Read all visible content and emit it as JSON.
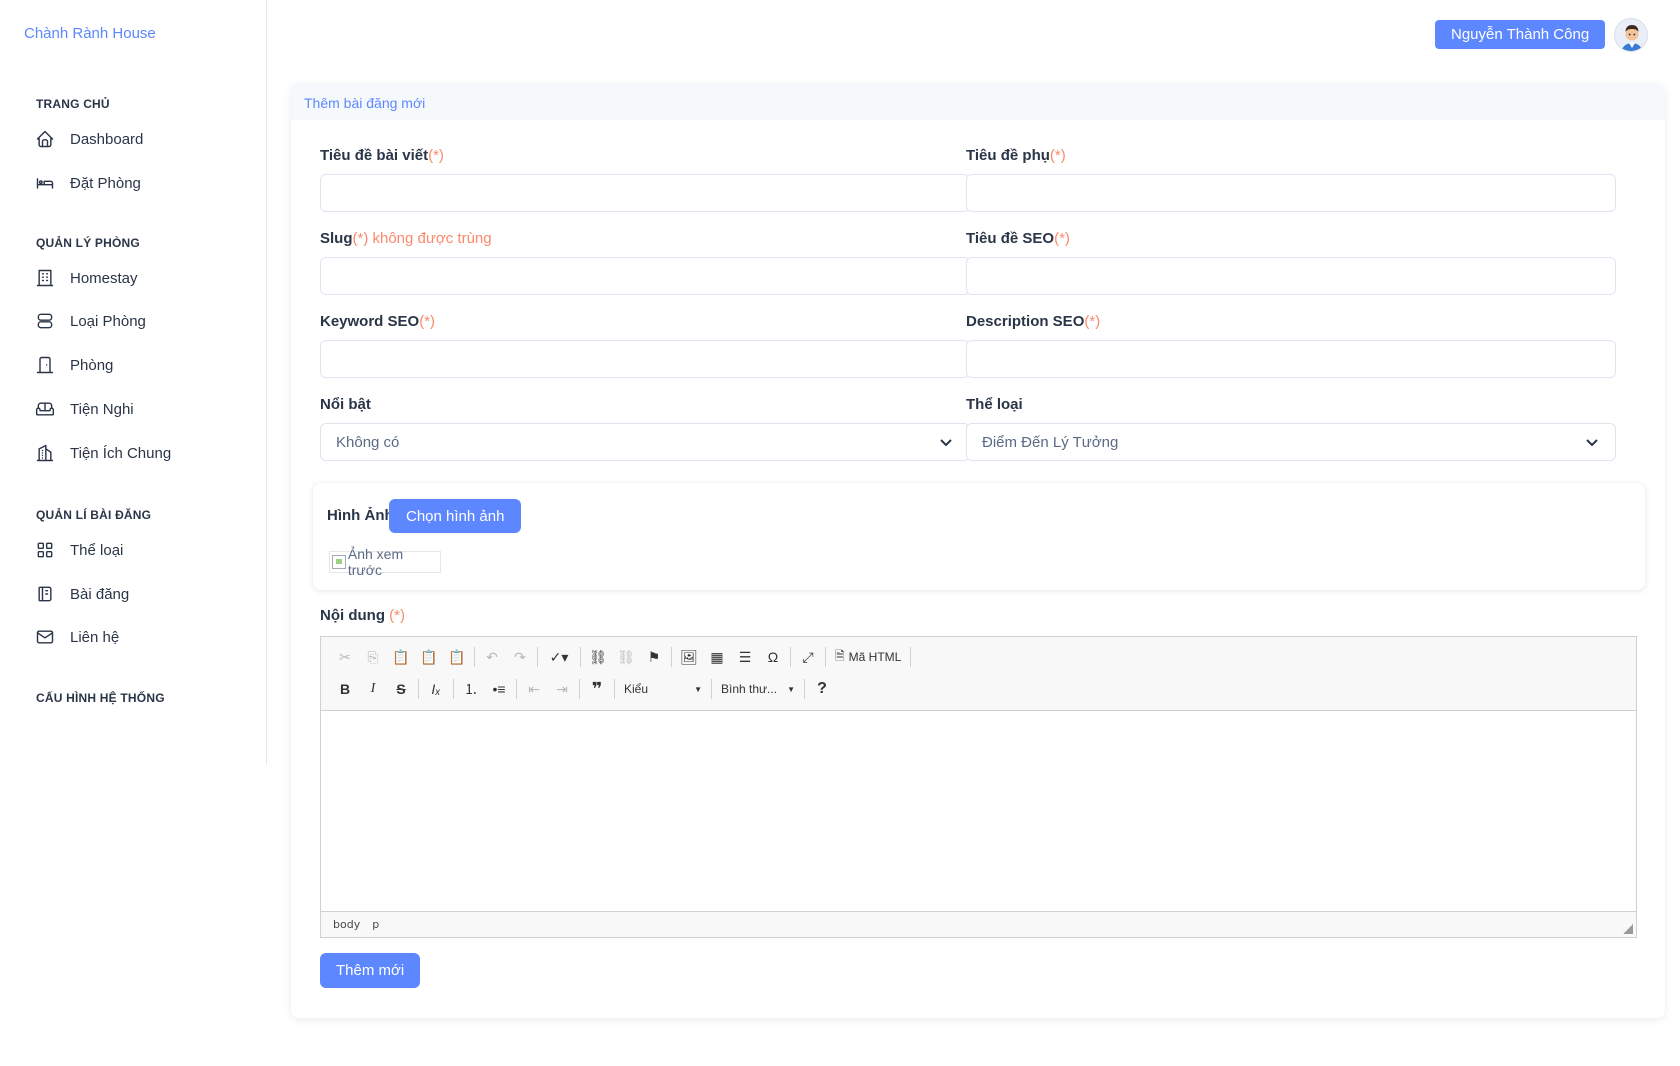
{
  "sidebar": {
    "brand": "Chành Rành House",
    "sections": [
      {
        "title": "TRANG CHỦ",
        "items": [
          {
            "label": "Dashboard",
            "icon": "home-icon"
          },
          {
            "label": "Đặt Phòng",
            "icon": "bed-icon"
          }
        ]
      },
      {
        "title": "QUẢN LÝ PHÒNG",
        "items": [
          {
            "label": "Homestay",
            "icon": "building-icon"
          },
          {
            "label": "Loại Phòng",
            "icon": "server-icon"
          },
          {
            "label": "Phòng",
            "icon": "door-icon"
          },
          {
            "label": "Tiện Nghi",
            "icon": "sofa-icon"
          },
          {
            "label": "Tiện Ích Chung",
            "icon": "buildings-icon"
          }
        ]
      },
      {
        "title": "QUẢN LÍ BÀI ĐĂNG",
        "items": [
          {
            "label": "Thể loại",
            "icon": "category-icon"
          },
          {
            "label": "Bài đăng",
            "icon": "notebook-icon"
          },
          {
            "label": "Liên hệ",
            "icon": "mail-icon"
          }
        ]
      },
      {
        "title": "CẤU HÌNH HỆ THỐNG",
        "items": []
      }
    ]
  },
  "header": {
    "user_name": "Nguyễn Thành Công",
    "avatar_icon": "user-avatar"
  },
  "card": {
    "title": "Thêm bài đăng mới"
  },
  "form": {
    "title_label": "Tiêu đề bài viết",
    "subtitle_label": "Tiêu đề phụ",
    "slug_label": "Slug",
    "slug_note": "(*) không được trùng",
    "seo_title_label": "Tiêu đề SEO",
    "keyword_label": "Keyword SEO",
    "description_label": "Description SEO",
    "featured_label": "Nổi bật",
    "featured_value": "Không có",
    "category_label": "Thể loại",
    "category_value": "Điểm Đến Lý Tưởng",
    "required_mark": "(*)",
    "image_label": "Hình Ảnh",
    "choose_image": "Chọn hình ảnh",
    "preview_alt": "Ảnh xem trước",
    "content_label": "Nội dung ",
    "submit": "Thêm mới"
  },
  "editor": {
    "html_button": "Mã HTML",
    "style_combo": "Kiểu",
    "format_combo": "Bình thư...",
    "status_path": [
      "body",
      "p"
    ]
  },
  "colors": {
    "accent": "#5d87ff",
    "required": "#fa896b",
    "text": "#2a3547"
  }
}
